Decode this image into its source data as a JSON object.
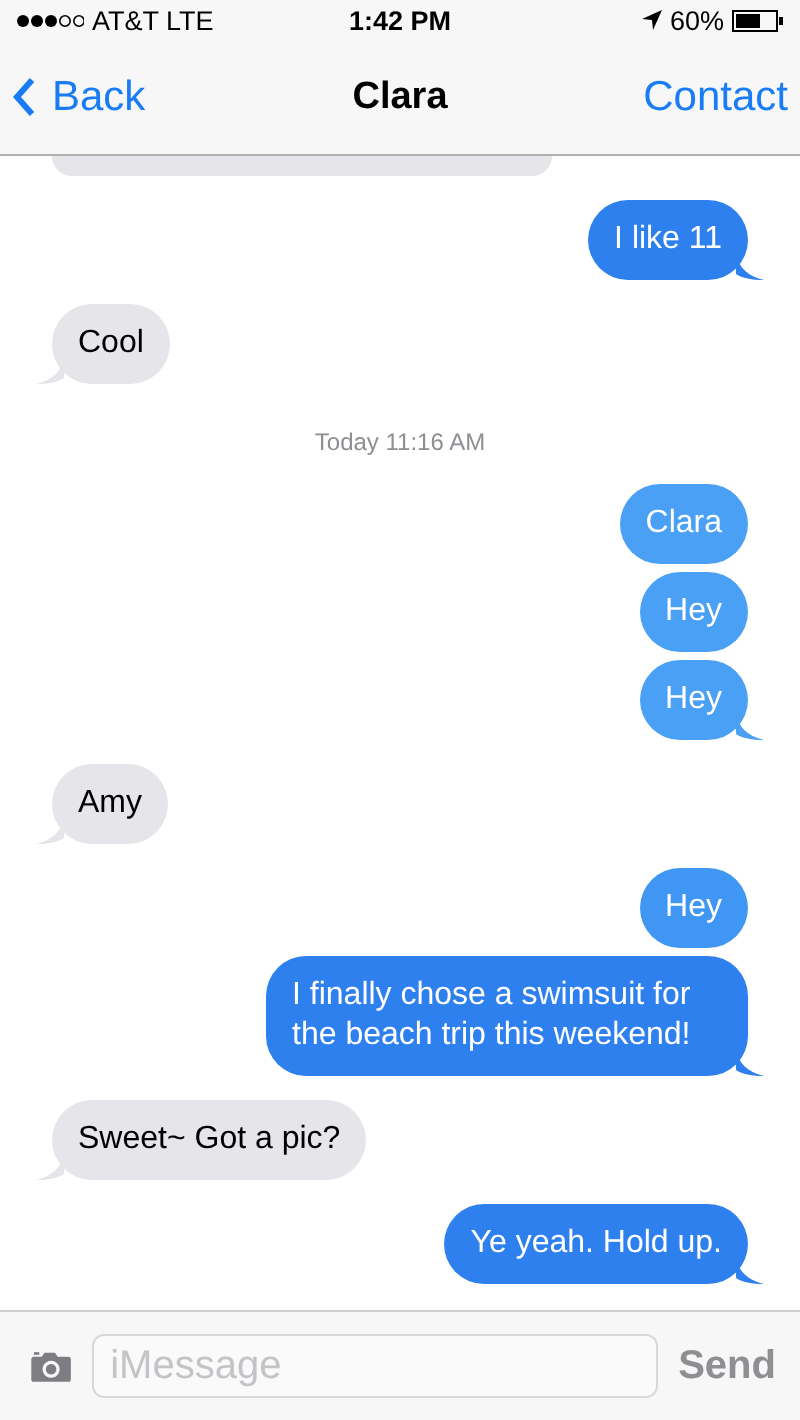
{
  "status_bar": {
    "carrier": "AT&T LTE",
    "time": "1:42 PM",
    "battery": "60%"
  },
  "nav_bar": {
    "back": "Back",
    "title": "Clara",
    "action": "Contact"
  },
  "messages": [
    {
      "kind": "partial"
    },
    {
      "kind": "sent",
      "text": "I like 11",
      "color": "#2f80ef",
      "tail": true
    },
    {
      "kind": "received",
      "text": "Cool",
      "tail": true
    },
    {
      "kind": "timestamp",
      "text": "Today 11:16 AM"
    },
    {
      "kind": "sent",
      "text": "Clara",
      "color": "#4aa0f5",
      "tail": false
    },
    {
      "kind": "sent",
      "text": "Hey",
      "color": "#4aa0f5",
      "tail": false
    },
    {
      "kind": "sent",
      "text": "Hey",
      "color": "#4aa0f5",
      "tail": true
    },
    {
      "kind": "received",
      "text": "Amy",
      "tail": true
    },
    {
      "kind": "sent",
      "text": "Hey",
      "color": "#3f96f3",
      "tail": false
    },
    {
      "kind": "sent",
      "text": "I finally chose a swimsuit for the beach trip this weekend!",
      "color": "#2f80ef",
      "tail": true
    },
    {
      "kind": "received",
      "text": "Sweet~ Got a pic?",
      "tail": true
    },
    {
      "kind": "sent",
      "text": "Ye yeah. Hold up.",
      "color": "#2f80ef",
      "tail": true
    }
  ],
  "composer": {
    "placeholder": "iMessage",
    "send": "Send"
  }
}
